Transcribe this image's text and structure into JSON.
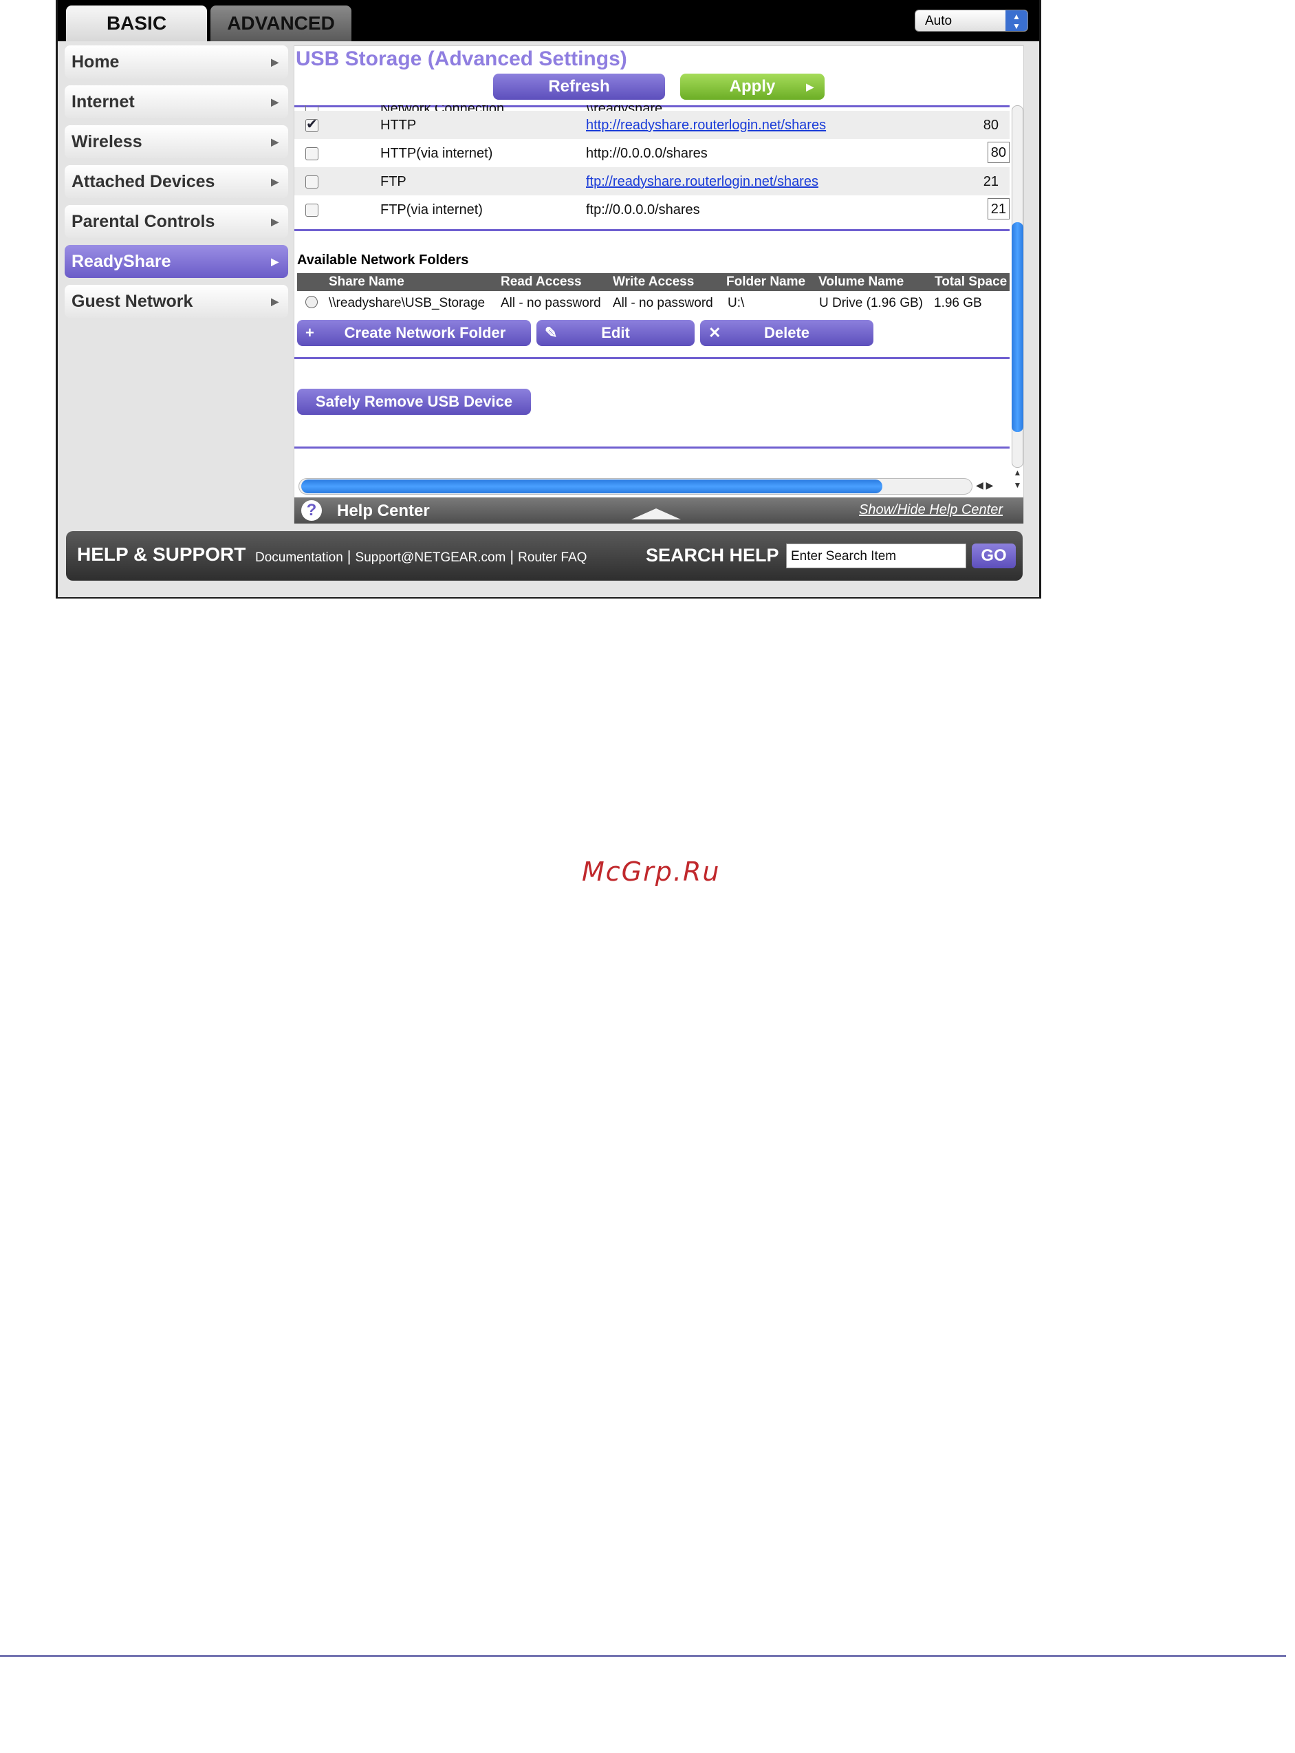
{
  "tabs": {
    "basic": "BASIC",
    "advanced": "ADVANCED"
  },
  "language_select": {
    "value": "Auto"
  },
  "sidebar": {
    "items": [
      {
        "label": "Home"
      },
      {
        "label": "Internet"
      },
      {
        "label": "Wireless"
      },
      {
        "label": "Attached Devices"
      },
      {
        "label": "Parental Controls"
      },
      {
        "label": "ReadyShare",
        "active": true
      },
      {
        "label": "Guest Network"
      }
    ]
  },
  "main": {
    "title": "USB Storage (Advanced Settings)",
    "refresh_label": "Refresh",
    "apply_label": "Apply",
    "access_rows_clipped": {
      "name": "Network Connection",
      "link": "\\\\readyshare"
    },
    "access_rows": [
      {
        "checked": true,
        "name": "HTTP",
        "link": "http://readyshare.routerlogin.net/shares",
        "port": "80",
        "editable": false
      },
      {
        "checked": false,
        "name": "HTTP(via internet)",
        "link": "http://0.0.0.0/shares",
        "port": "80",
        "editable": true
      },
      {
        "checked": false,
        "name": "FTP",
        "link": "ftp://readyshare.routerlogin.net/shares",
        "port": "21",
        "editable": false
      },
      {
        "checked": false,
        "name": "FTP(via internet)",
        "link": "ftp://0.0.0.0/shares",
        "port": "21",
        "editable": true
      }
    ],
    "folders_heading": "Available Network Folders",
    "folders_columns": [
      "Share Name",
      "Read Access",
      "Write Access",
      "Folder Name",
      "Volume Name",
      "Total Space"
    ],
    "folders_rows": [
      {
        "share_name": "\\\\readyshare\\USB_Storage",
        "read_access": "All - no password",
        "write_access": "All - no password",
        "folder_name": "U:\\",
        "volume_name": "U Drive (1.96 GB)",
        "total_space": "1.96 GB"
      }
    ],
    "create_folder_label": "Create Network Folder",
    "edit_label": "Edit",
    "delete_label": "Delete",
    "safely_remove_label": "Safely Remove USB Device"
  },
  "help_center": {
    "title": "Help Center",
    "toggle_label": "Show/Hide Help Center"
  },
  "footer": {
    "help_support": "HELP & SUPPORT",
    "documentation": "Documentation",
    "support_email": "Support@NETGEAR.com",
    "router_faq": "Router FAQ",
    "search_help": "SEARCH HELP",
    "search_placeholder": "Enter Search Item",
    "go_label": "GO"
  },
  "watermark": "McGrp.Ru",
  "colors": {
    "accent": "#6f5fd0",
    "apply_green": "#7cbe2e",
    "link_blue": "#1a3cd8",
    "watermark_red": "#c0282c"
  }
}
